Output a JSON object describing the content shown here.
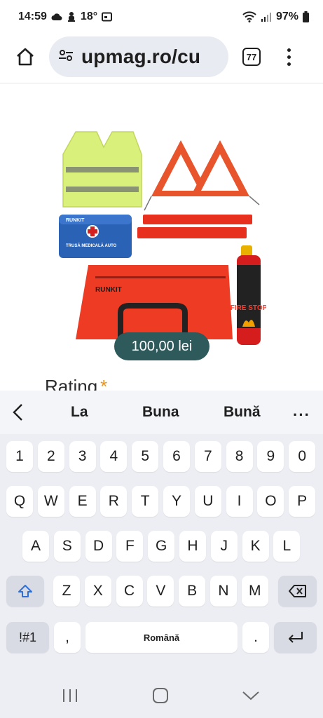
{
  "status_bar": {
    "time": "14:59",
    "temperature": "18°",
    "battery": "97%"
  },
  "browser": {
    "url": "upmag.ro/cu",
    "tab_count": "77"
  },
  "page": {
    "price": "100,00 lei",
    "rating_label": "Rating",
    "required_marker": "*",
    "product_image_texts": {
      "kit_brand": "RUNKIT",
      "kit_label": "TRUSĂ MEDICALĂ AUTO",
      "extinguisher_label": "FIRE STOP"
    }
  },
  "keyboard": {
    "suggestions": [
      "La",
      "Buna",
      "Bună"
    ],
    "row_numbers": [
      "1",
      "2",
      "3",
      "4",
      "5",
      "6",
      "7",
      "8",
      "9",
      "0"
    ],
    "row_1": [
      "Q",
      "W",
      "E",
      "R",
      "T",
      "Y",
      "U",
      "I",
      "O",
      "P"
    ],
    "row_2": [
      "A",
      "S",
      "D",
      "F",
      "G",
      "H",
      "J",
      "K",
      "L"
    ],
    "row_3": [
      "Z",
      "X",
      "C",
      "V",
      "B",
      "N",
      "M"
    ],
    "symbols_key": "!#1",
    "comma_key": ",",
    "space_label": "Română",
    "period_key": "."
  },
  "colors": {
    "price_badge": "#2e5a5c",
    "required_star": "#e89524",
    "keyboard_bg": "#edeef3",
    "url_pill": "#e8ebf1"
  }
}
